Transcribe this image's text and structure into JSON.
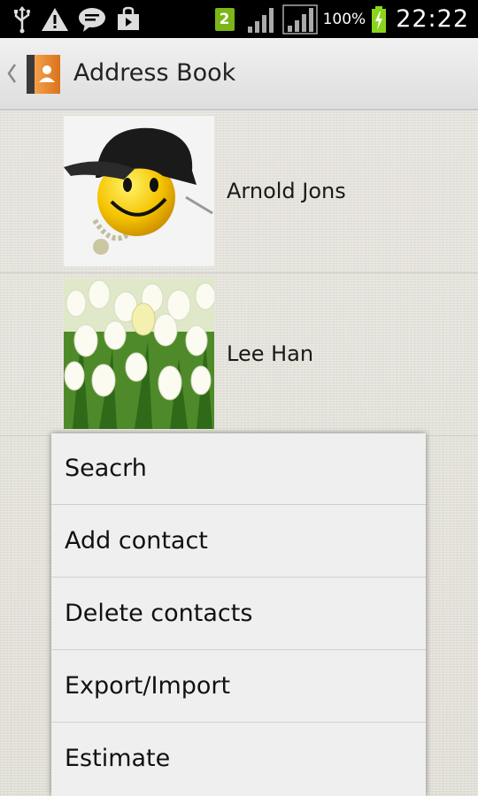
{
  "status_bar": {
    "notification_icons": [
      "usb-icon",
      "warning-icon",
      "chat-bubble-icon",
      "shopping-bag-icon"
    ],
    "sim_badge": "2",
    "battery_percent": "100%",
    "time": "22:22"
  },
  "action_bar": {
    "title": "Address Book",
    "icon": "address-book-icon"
  },
  "contacts": [
    {
      "name": "Arnold Jons",
      "avatar": "smiley-cap-avatar"
    },
    {
      "name": "Lee Han",
      "avatar": "white-tulips-avatar"
    }
  ],
  "menu": {
    "items": [
      {
        "label": "Seacrh"
      },
      {
        "label": "Add contact"
      },
      {
        "label": "Delete contacts"
      },
      {
        "label": "Export/Import"
      },
      {
        "label": "Estimate"
      }
    ]
  },
  "colors": {
    "status_bar_bg": "#000000",
    "action_bar_bg": "#e8e8e8",
    "menu_bg": "#efefef",
    "sim_badge": "#7cb518",
    "battery_charge": "#8bd41c"
  }
}
